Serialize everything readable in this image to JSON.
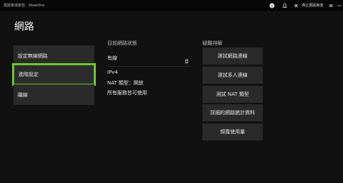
{
  "topbar": {
    "stream_label": "測試串流來自：XboxOne",
    "stop_label": "停止測試串流",
    "icons": [
      "xbox-icon",
      "notification-icon",
      "close-icon",
      "menu-icon",
      "more-icon"
    ]
  },
  "page": {
    "title": "網路"
  },
  "left_menu": {
    "items": [
      {
        "label": "設定無線網路"
      },
      {
        "label": "進階設定"
      },
      {
        "label": "離線"
      }
    ]
  },
  "status": {
    "heading": "目前網路狀態",
    "connection": "有線",
    "ip_version": "IPv4",
    "nat_type": "NAT 類型：開放",
    "services": "所有服務皆可使用"
  },
  "troubleshoot": {
    "heading": "疑難排解",
    "items": [
      {
        "label": "測試網路連線"
      },
      {
        "label": "測試多人連線"
      },
      {
        "label": "測試 NAT 類型"
      },
      {
        "label": "詳細的網路統計資料"
      },
      {
        "label": "頻寬使用量"
      }
    ]
  }
}
